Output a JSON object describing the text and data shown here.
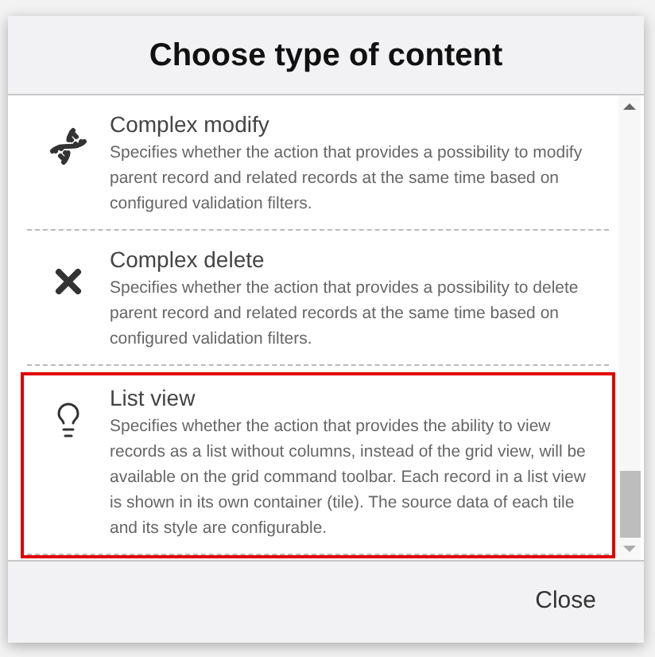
{
  "dialog": {
    "title": "Choose type of content",
    "items": [
      {
        "title": "Complex modify",
        "description": "Specifies whether the action that provides a possibility to modify parent record and related records at the same time based on configured validation filters.",
        "selected": false
      },
      {
        "title": "Complex delete",
        "description": "Specifies whether the action that provides a possibility to delete parent record and related records at the same time based on configured validation filters.",
        "selected": false
      },
      {
        "title": "List view",
        "description": "Specifies whether the action that provides the ability to view records as a list without columns, instead of the grid view, will be available on the grid command toolbar. Each record in a list view is shown in its own container (tile). The source data of each tile and its style are configurable.",
        "selected": true
      }
    ],
    "close_button": "Close"
  }
}
